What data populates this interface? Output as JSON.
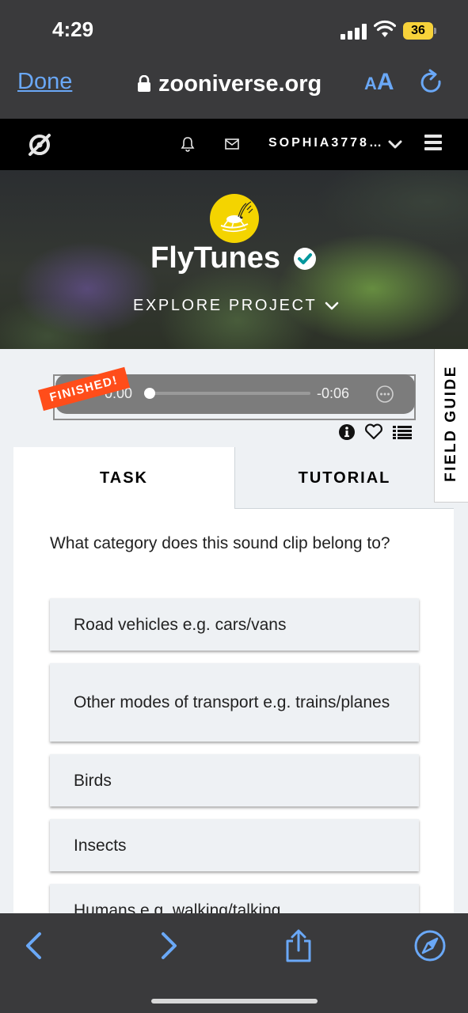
{
  "status_bar": {
    "time": "4:29",
    "battery_percent": "36",
    "signal_icon": "cellular-signal-icon",
    "wifi_icon": "wifi-icon",
    "battery_color": "#f7d23a"
  },
  "browser": {
    "done_label": "Done",
    "url": "zooniverse.org",
    "text_size_label_small": "A",
    "text_size_label_big": "A",
    "accent_color": "#6aa8f7"
  },
  "site_nav": {
    "username": "SOPHIA3778…",
    "icons": [
      "zooniverse-logo-icon",
      "bell-icon",
      "mail-icon",
      "chevron-down-icon",
      "hamburger-menu-icon"
    ]
  },
  "project": {
    "title": "FlyTunes",
    "explore_label": "EXPLORE PROJECT"
  },
  "audio_player": {
    "elapsed": "0:00",
    "remaining": "-0:06",
    "progress": 0,
    "finished_label": "FINISHED!"
  },
  "tabs": [
    {
      "label": "TASK",
      "active": true
    },
    {
      "label": "TUTORIAL",
      "active": false
    }
  ],
  "task": {
    "question": "What category does this sound clip belong to?",
    "answers": [
      "Road vehicles e.g. cars/vans",
      "Other modes of transport e.g. trains/planes",
      "Birds",
      "Insects",
      "Humans e.g. walking/talking"
    ]
  },
  "field_guide_label": "FIELD GUIDE"
}
